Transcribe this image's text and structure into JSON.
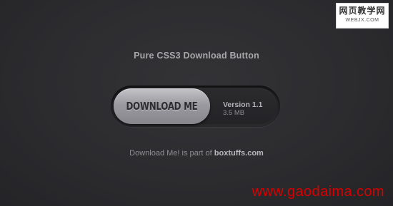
{
  "page": {
    "title": "Pure CSS3 Download Button"
  },
  "download": {
    "button_label": "DOWNLOAD ME",
    "version": "Version 1.1",
    "size": "3.5 MB"
  },
  "footer": {
    "text": "Download Me! is part of ",
    "link_text": "boxtuffs.com"
  },
  "watermarks": {
    "corner_cn": "网页教学网",
    "corner_url": "WEBJX.COM",
    "source": "www.gaodaima.com",
    "source_color": "#d80000"
  },
  "colors": {
    "background": "#2d2d30",
    "button_light": "#c4c4c9",
    "button_dark": "#86868c"
  }
}
